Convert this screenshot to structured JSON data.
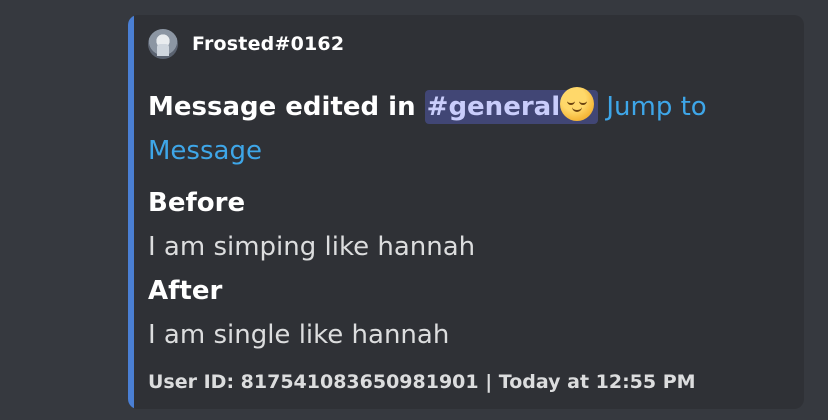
{
  "embed": {
    "accent_color": "#4a7fd4",
    "author": {
      "name": "Frosted#0162",
      "avatar_icon": "avatar-icon"
    },
    "title": {
      "prefix": "Message edited in ",
      "channel": "#general",
      "emoji": "relieved-face-emoji",
      "jump_link": "Jump to Message"
    },
    "fields": [
      {
        "name": "Before",
        "value": "I am simping like hannah"
      },
      {
        "name": "After",
        "value": "I am single like hannah"
      }
    ],
    "footer": "User ID: 817541083650981901 | Today at 12:55 PM"
  }
}
